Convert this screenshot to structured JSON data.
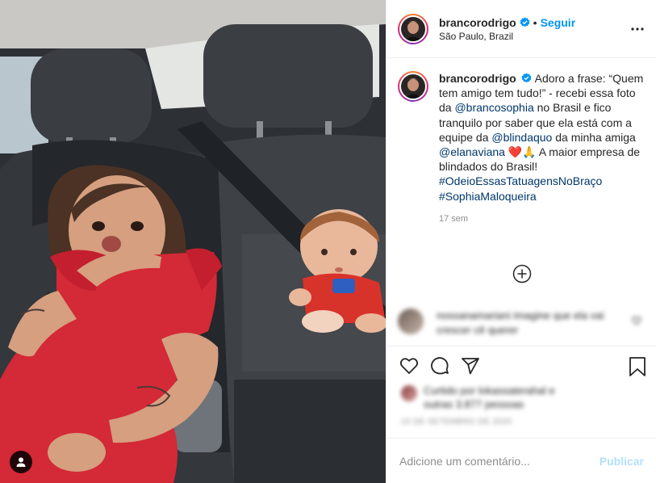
{
  "post": {
    "username": "brancorodrigo",
    "verified": true,
    "follow_label": "Seguir",
    "location": "São Paulo, Brazil",
    "caption": {
      "segments": [
        {
          "type": "text",
          "value": "Adoro a frase: “Quem tem amigo tem tudo!” - recebi essa foto da "
        },
        {
          "type": "link",
          "value": "@brancosophia"
        },
        {
          "type": "text",
          "value": " no Brasil e fico tranquilo por saber que ela está com a equipe da "
        },
        {
          "type": "link",
          "value": "@blindaquo"
        },
        {
          "type": "text",
          "value": " da minha amiga "
        },
        {
          "type": "link",
          "value": "@elanaviana"
        },
        {
          "type": "text",
          "value": " ❤️🙏 A maior empresa de blindados do Brasil! "
        },
        {
          "type": "link",
          "value": "#OdeioEssasTatuagensNoBraço"
        },
        {
          "type": "text",
          "value": " "
        },
        {
          "type": "link",
          "value": "#SophiaMaloqueira"
        }
      ]
    },
    "time_ago": "17 sem"
  },
  "comment_preview": {
    "text": "nossanamariani imagine que ela vai crescer cê querer"
  },
  "likes": {
    "text": "Curtido por lokassaterahal e outras 3.877 pessoas"
  },
  "post_date": "24 DE SETEMBRO DE 2020",
  "add_comment": {
    "placeholder": "Adicione um comentário...",
    "publish_label": "Publicar"
  },
  "icons": {
    "more": "more-horizontal-icon",
    "load_more": "plus-circle-icon",
    "like": "heart-icon",
    "comment": "comment-icon",
    "share": "share-icon",
    "save": "bookmark-icon",
    "verified": "verified-badge-icon",
    "user_tags": "user-tag-icon"
  },
  "colors": {
    "accent": "#0095f6",
    "link": "#00376b",
    "muted": "#8e8e8e",
    "publish_disabled": "#b2dffc"
  }
}
